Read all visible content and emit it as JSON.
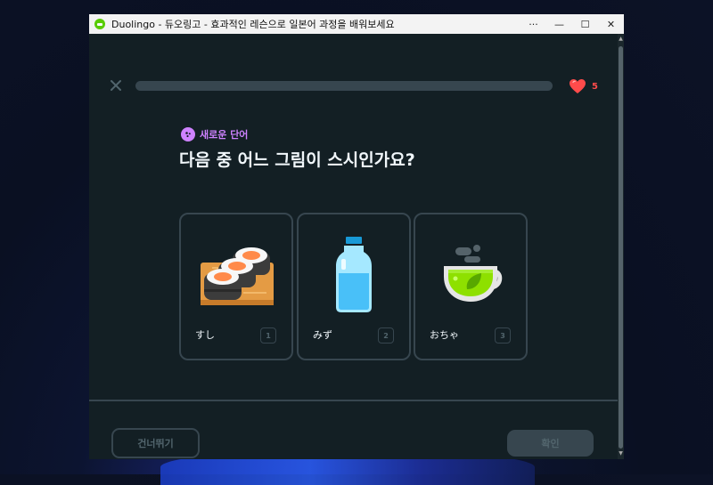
{
  "window": {
    "title": "Duolingo - 듀오링고 - 효과적인 레슨으로 일본어 과정을 배워보세요",
    "controls": {
      "more": "···",
      "minimize": "—",
      "maximize": "☐",
      "close": "✕"
    }
  },
  "header": {
    "close_icon": "close-icon",
    "progress": 0,
    "hearts": "5",
    "heart_color": "#ff4b4b"
  },
  "lesson": {
    "new_word_label": "새로운 단어",
    "question": "다음 중 어느 그림이 스시인가요?",
    "accent_color": "#ce82ff"
  },
  "choices": [
    {
      "word": "すし",
      "number": "1",
      "icon": "sushi-icon"
    },
    {
      "word": "みず",
      "number": "2",
      "icon": "water-bottle-icon"
    },
    {
      "word": "おちゃ",
      "number": "3",
      "icon": "tea-cup-icon"
    }
  ],
  "footer": {
    "skip_label": "건너뛰기",
    "check_label": "확인"
  }
}
